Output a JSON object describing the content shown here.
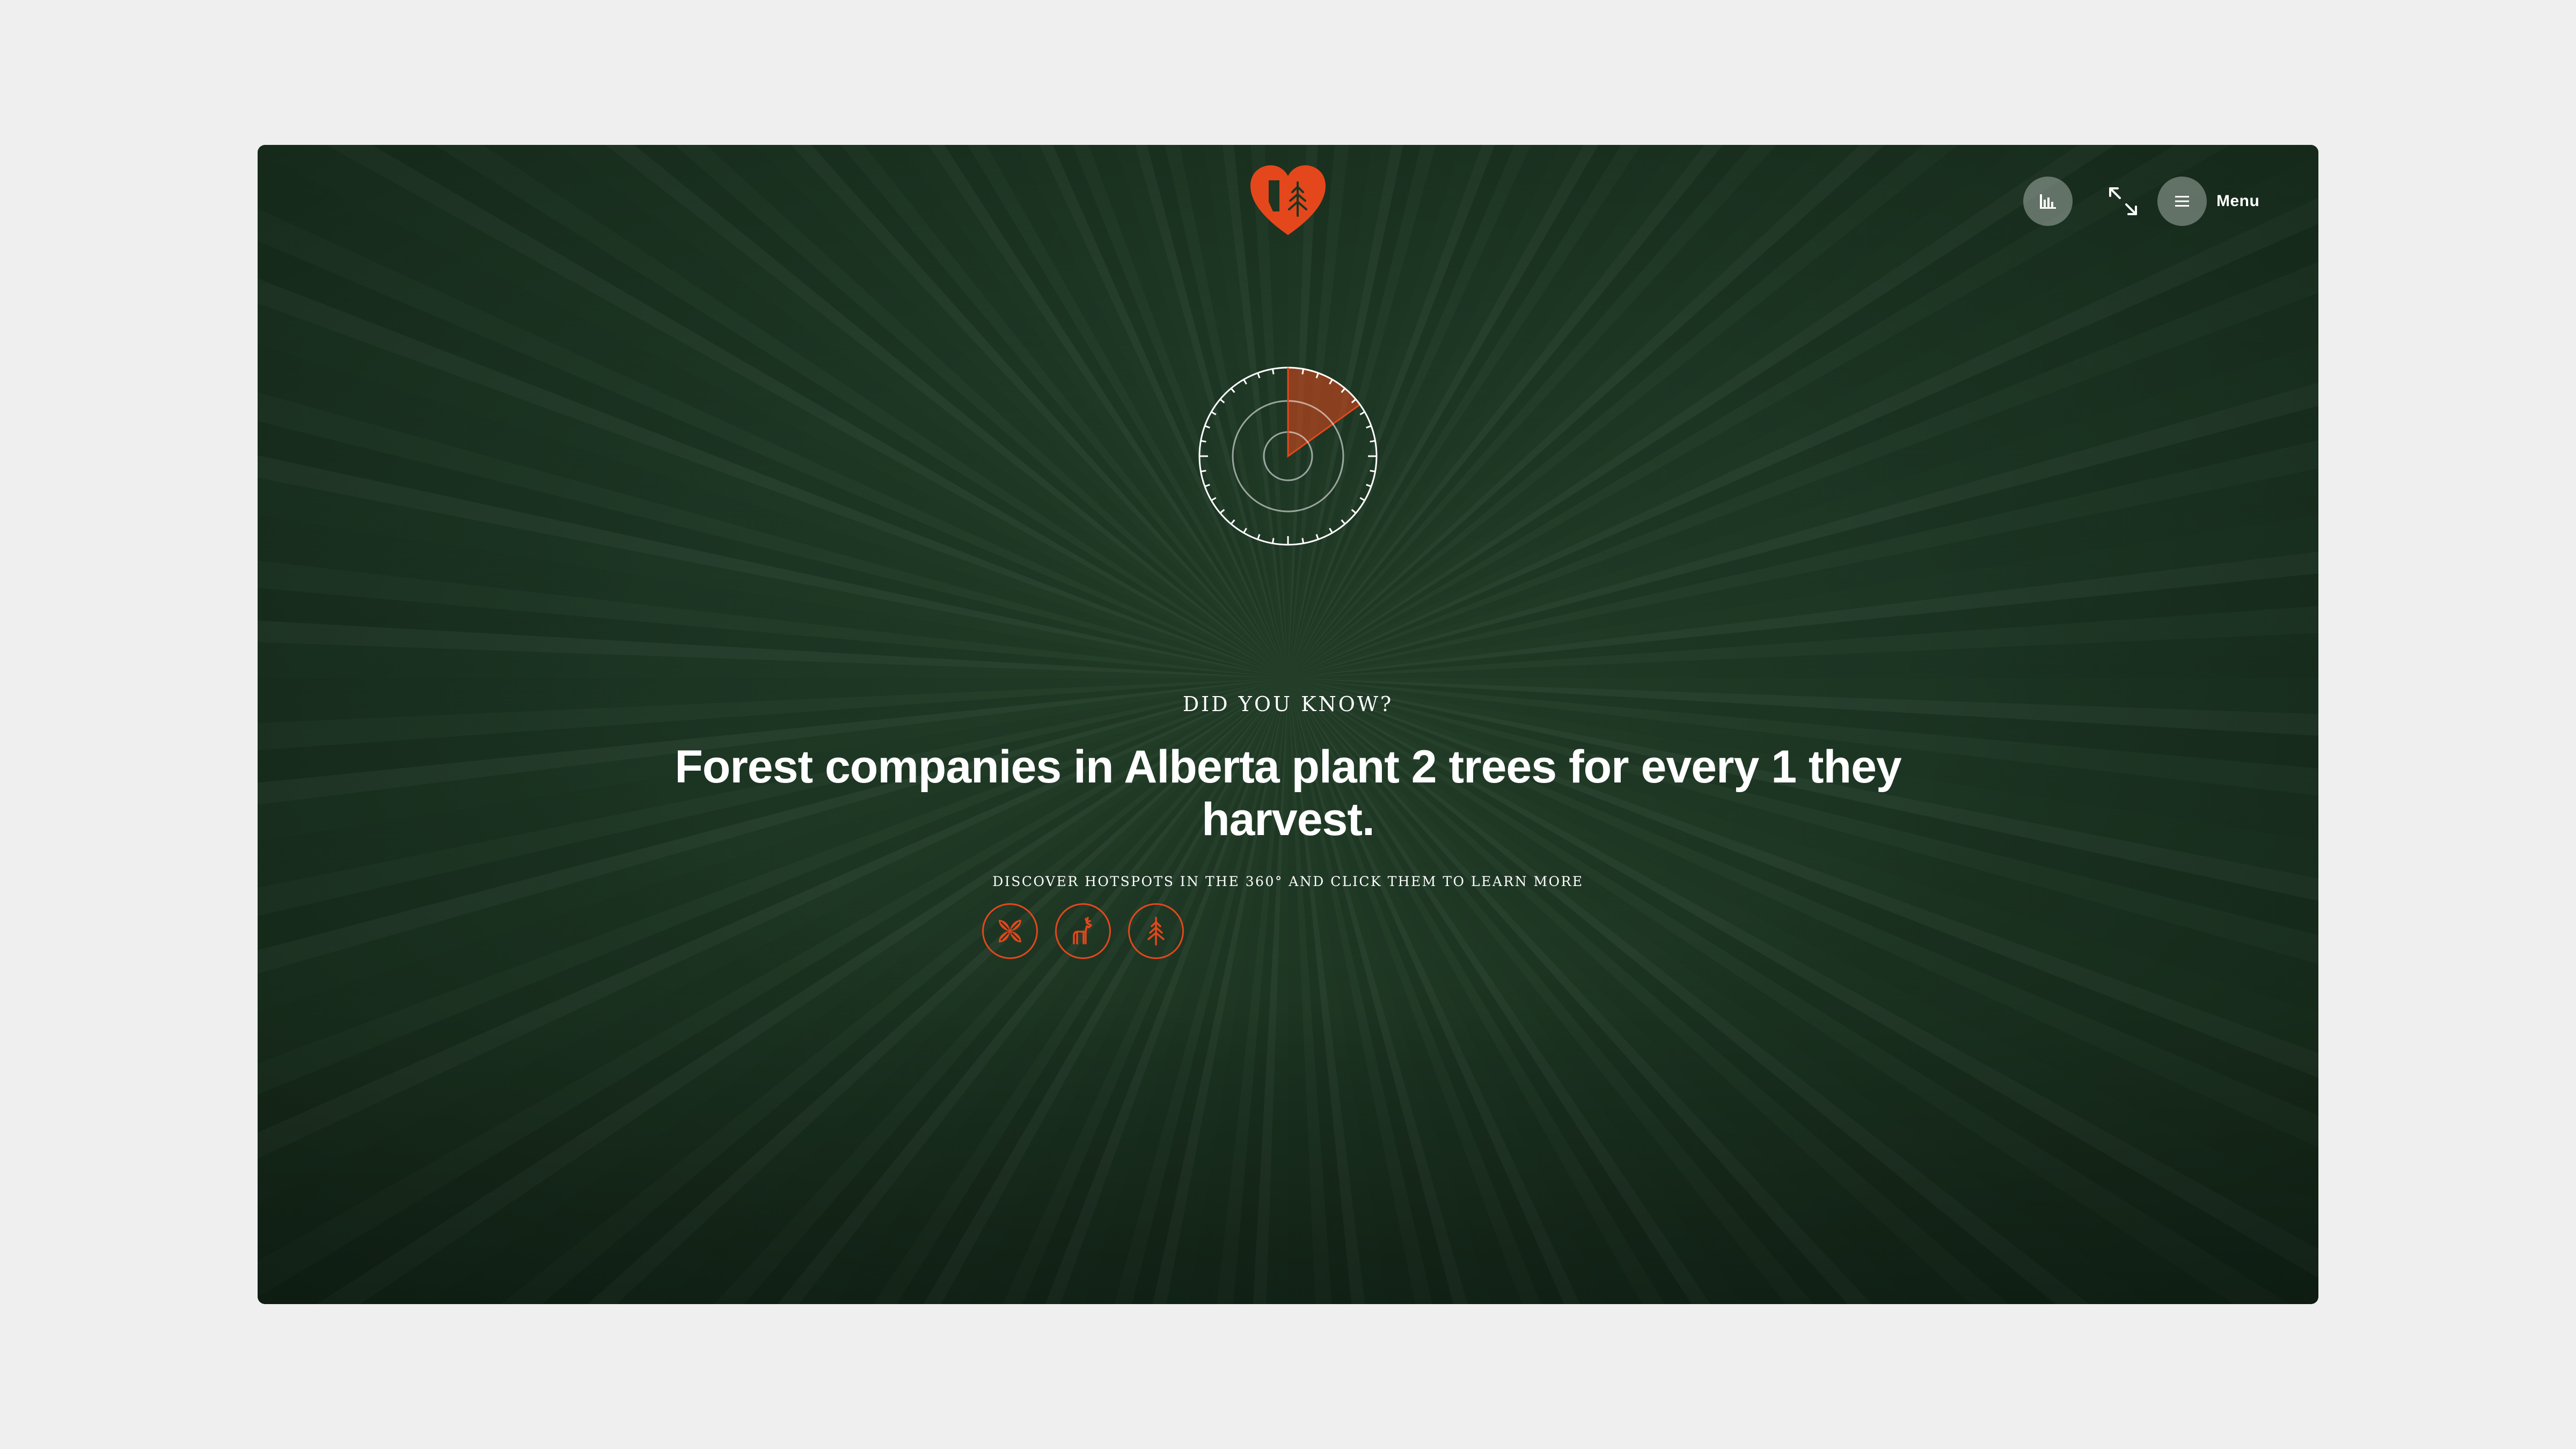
{
  "colors": {
    "accent": "#e4471b",
    "page_background": "#efefef",
    "forest_green": "#1d3522"
  },
  "header": {
    "logo_icon": "alberta-heart-tree-logo",
    "stats_icon": "bar-chart-icon",
    "expand_icon": "fullscreen-expand-icon",
    "menu_icon": "hamburger-icon",
    "menu_label": "Menu"
  },
  "compass": {
    "icon": "radar-compass-icon"
  },
  "content": {
    "kicker": "DID YOU KNOW?",
    "headline": "Forest companies in Alberta plant 2 trees for every 1 they harvest.",
    "hint": "DISCOVER HOTSPOTS IN THE 360° AND CLICK THEM TO LEARN MORE"
  },
  "hotspots": [
    {
      "icon": "seed-leaves-icon"
    },
    {
      "icon": "deer-icon"
    },
    {
      "icon": "pine-tree-icon"
    }
  ]
}
